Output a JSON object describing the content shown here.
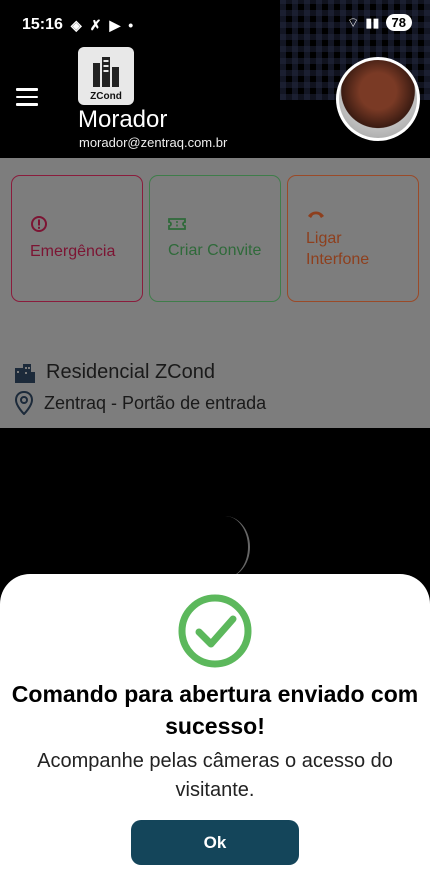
{
  "status_bar": {
    "time": "15:16",
    "battery": "78",
    "icons_left": [
      "diamond-icon",
      "missed-call-icon",
      "youtube-icon",
      "dot-icon"
    ],
    "icons_right": [
      "wifi-icon",
      "signal-icon",
      "battery-icon"
    ]
  },
  "header": {
    "logo_text": "ZCond",
    "user_name": "Morador",
    "user_email": "morador@zentraq.com.br"
  },
  "actions": [
    {
      "label": "Emergência",
      "icon": "alert-circle-icon",
      "color": "#7c1433"
    },
    {
      "label": "Criar Convite",
      "icon": "ticket-icon",
      "color": "#2f6a3a"
    },
    {
      "label": "Ligar Interfone",
      "icon": "phone-hangup-icon",
      "color": "#8e3f1d"
    }
  ],
  "location": {
    "condominium": "Residencial ZCond",
    "gate": "Zentraq - Portão de entrada"
  },
  "dialog": {
    "title": "Comando para abertura enviado com sucesso!",
    "message": "Acompanhe pelas câmeras o acesso do visitante.",
    "ok_label": "Ok",
    "accent": "#5cb85c",
    "button_color": "#14455a"
  }
}
